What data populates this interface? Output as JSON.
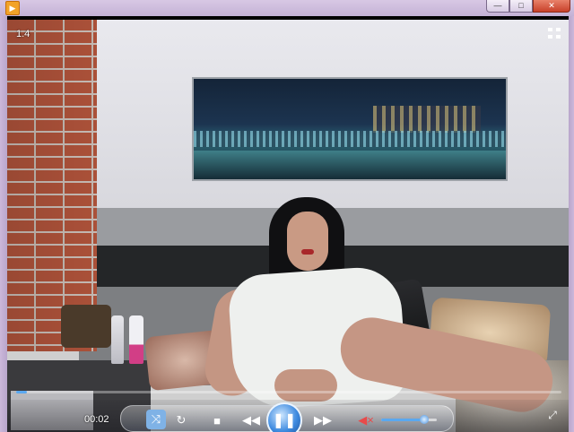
{
  "window": {
    "app_icon": "media-player-icon",
    "buttons": {
      "minimize": "—",
      "maximize": "□",
      "close": "✕"
    }
  },
  "overlay": {
    "playback_speed": "1.4",
    "fullscreen_icon": "compact-mode-icon"
  },
  "controls": {
    "elapsed_time": "00:02",
    "seek_progress": 0.01,
    "volume_level": 0.78,
    "play_state": "playing",
    "icons": {
      "shuffle": "shuffle-icon",
      "repeat": "repeat-icon",
      "stop": "stop-icon",
      "previous": "previous-icon",
      "pause": "pause-icon",
      "next": "next-icon",
      "mute": "mute-icon",
      "switch": "switch-to-library-icon"
    },
    "glyphs": {
      "shuffle": "⤨",
      "repeat": "↻",
      "stop": "■",
      "previous": "◀◀",
      "pause": "❚❚",
      "next": "▶▶",
      "mute": "◀×",
      "switch": "⤢"
    }
  },
  "colors": {
    "accent": "#5aa8f0",
    "titlebar": "#d2c2e0",
    "close_button": "#c8412a"
  }
}
